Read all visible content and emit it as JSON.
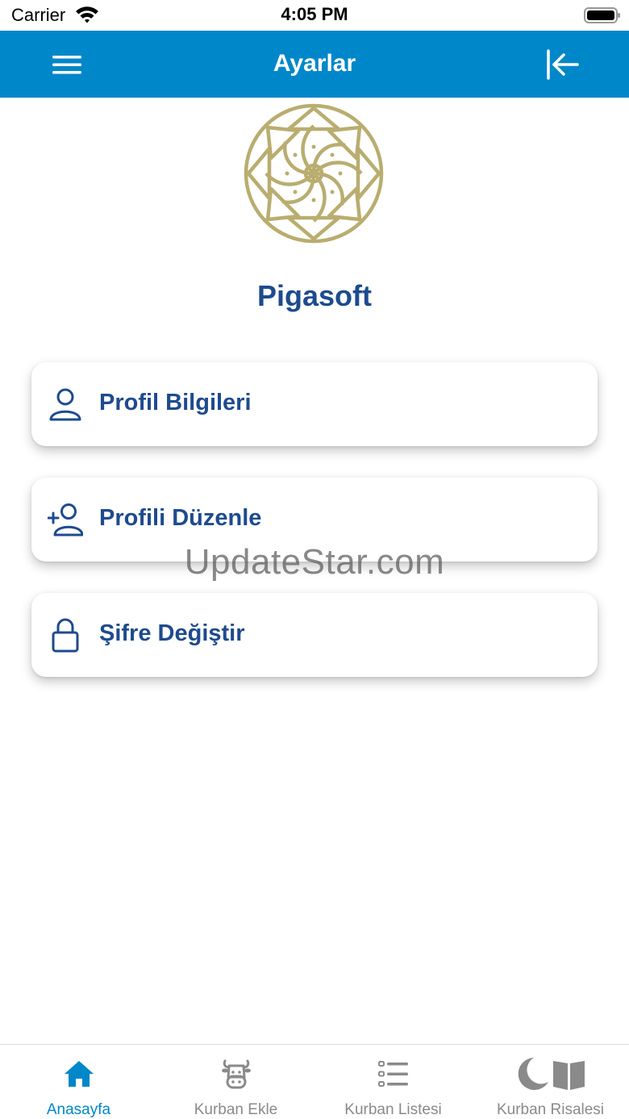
{
  "status_bar": {
    "carrier": "Carrier",
    "time": "4:05 PM"
  },
  "header": {
    "title": "Ayarlar",
    "menu_icon": "hamburger-menu-icon",
    "logout_icon": "logout-arrow-icon"
  },
  "organization": {
    "name": "Pigasoft",
    "logo_icon": "ornamental-rosette-logo"
  },
  "menu_cards": [
    {
      "label": "Profil Bilgileri",
      "icon": "user-icon"
    },
    {
      "label": "Profili Düzenle",
      "icon": "user-add-icon"
    },
    {
      "label": "Şifre Değiştir",
      "icon": "lock-icon"
    }
  ],
  "watermark": "UpdateStar.com",
  "tabs": [
    {
      "label": "Anasayfa",
      "icon": "home-icon",
      "active": true
    },
    {
      "label": "Kurban Ekle",
      "icon": "cow-head-icon",
      "active": false
    },
    {
      "label": "Kurban Listesi",
      "icon": "list-icon",
      "active": false
    },
    {
      "label": "Kurban Risalesi",
      "icon": "moon-book-icon",
      "active": false
    }
  ],
  "colors": {
    "primary": "#0087c9",
    "heading": "#1e4b8e",
    "logo_gold": "#b9ad6f",
    "inactive": "#8a8a8a"
  }
}
